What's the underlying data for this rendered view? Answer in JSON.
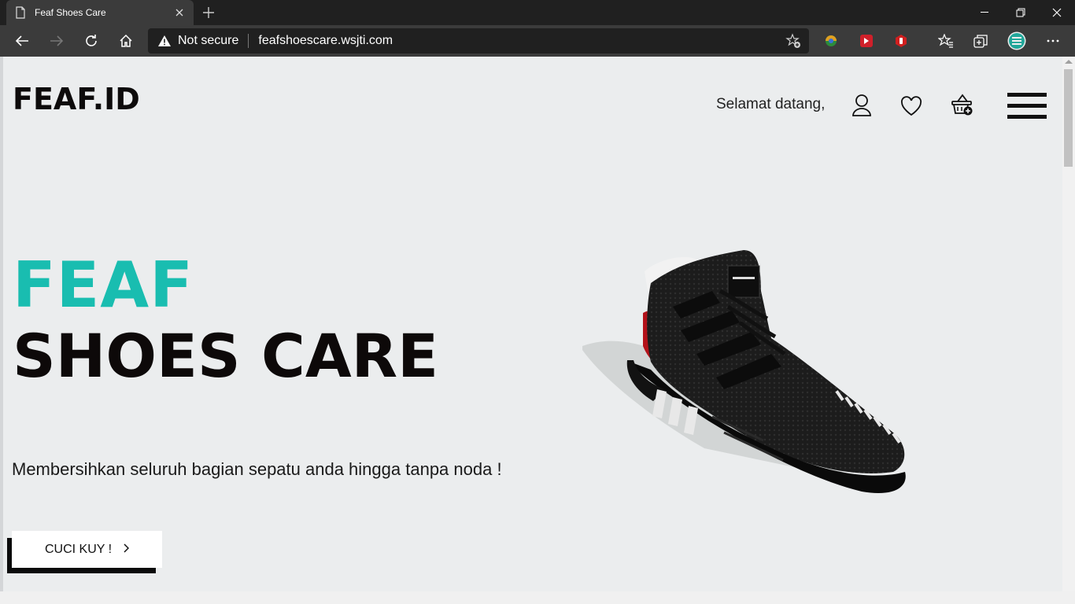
{
  "browser": {
    "tab_title": "Feaf Shoes Care",
    "security_label": "Not secure",
    "url": "feafshoescare.wsjti.com"
  },
  "site": {
    "logo": "FEAF.ID",
    "welcome": "Selamat datang,",
    "hero_line1": "FEAF",
    "hero_line2": "SHOES CARE",
    "tagline": "Membersihkan seluruh bagian sepatu anda hingga tanpa noda !",
    "cta_label": "CUCI KUY !",
    "accent_color": "#19bdb0"
  }
}
